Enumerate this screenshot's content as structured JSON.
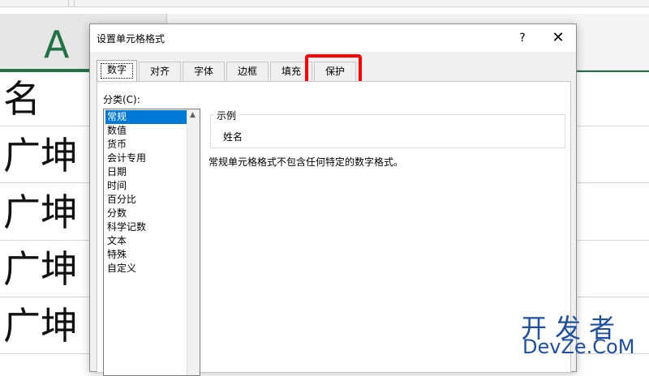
{
  "spreadsheet": {
    "column_header": "A",
    "cells": [
      "名",
      "广坤",
      "广坤",
      "广坤",
      "广坤"
    ]
  },
  "dialog": {
    "title": "设置单元格格式",
    "help_label": "?",
    "close_label": "✕",
    "tabs": [
      {
        "label": "数字",
        "active": true
      },
      {
        "label": "对齐",
        "active": false
      },
      {
        "label": "字体",
        "active": false
      },
      {
        "label": "边框",
        "active": false
      },
      {
        "label": "填充",
        "active": false
      },
      {
        "label": "保护",
        "active": false,
        "highlighted": true
      }
    ],
    "category_label": "分类(C):",
    "categories": [
      "常规",
      "数值",
      "货币",
      "会计专用",
      "日期",
      "时间",
      "百分比",
      "分数",
      "科学记数",
      "文本",
      "特殊",
      "自定义"
    ],
    "selected_category": "常规",
    "sample_label": "示例",
    "sample_value": "姓名",
    "description": "常规单元格格式不包含任何特定的数字格式。"
  },
  "watermark": {
    "line1": "开发者",
    "line2": "DevZe.CoM"
  },
  "colors": {
    "excel_green": "#217346",
    "selection_blue": "#0078d7",
    "highlight_red": "#ff0000",
    "watermark_blue": "#1f4fa3"
  }
}
